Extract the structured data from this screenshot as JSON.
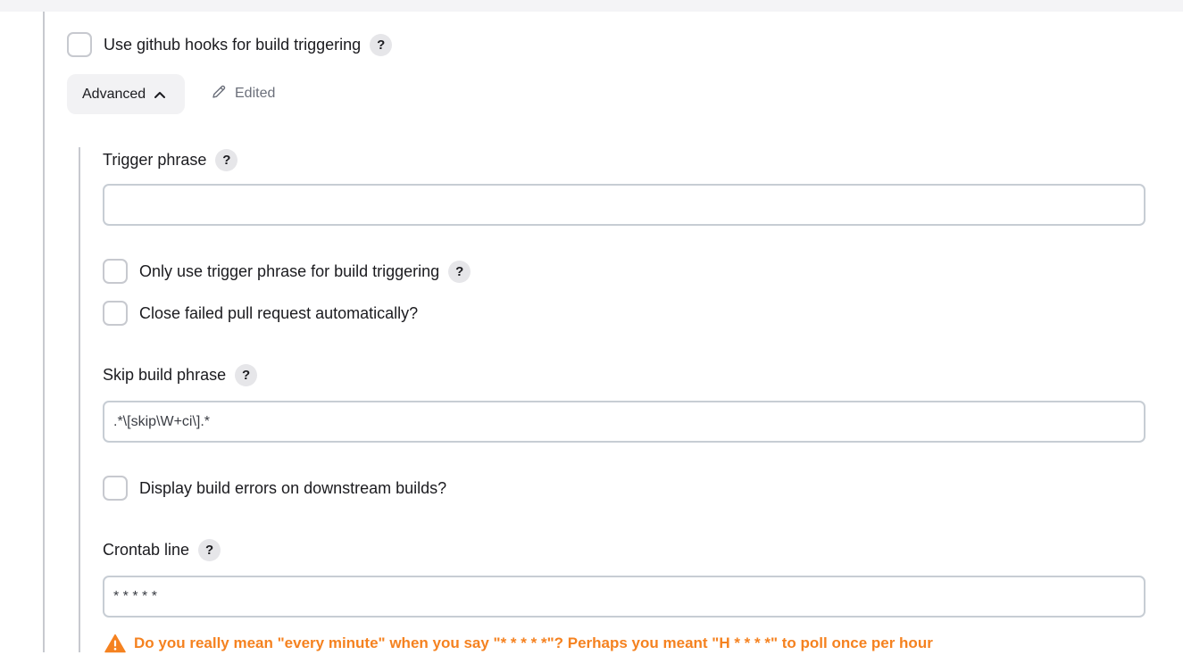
{
  "github_hooks": {
    "label": "Use github hooks for build triggering",
    "checked": false,
    "help": "?"
  },
  "advanced": {
    "label": "Advanced",
    "chevron_icon": "chevron-up-icon",
    "edited_icon": "pencil-icon",
    "edited_label": "Edited"
  },
  "trigger_phrase": {
    "label": "Trigger phrase",
    "help": "?",
    "value": ""
  },
  "only_trigger": {
    "label": "Only use trigger phrase for build triggering",
    "checked": false,
    "help": "?"
  },
  "close_failed": {
    "label": "Close failed pull request automatically?",
    "checked": false
  },
  "skip_build": {
    "label": "Skip build phrase",
    "help": "?",
    "value": ".*\\[skip\\W+ci\\].*"
  },
  "display_errors": {
    "label": "Display build errors on downstream builds?",
    "checked": false
  },
  "crontab": {
    "label": "Crontab line",
    "help": "?",
    "value": "* * * * *",
    "warning_icon": "warning-triangle-icon",
    "warning": "Do you really mean \"every minute\" when you say \"* * * * *\"? Perhaps you meant \"H * * * *\" to poll once per hour",
    "warning_color": "#f58220"
  }
}
